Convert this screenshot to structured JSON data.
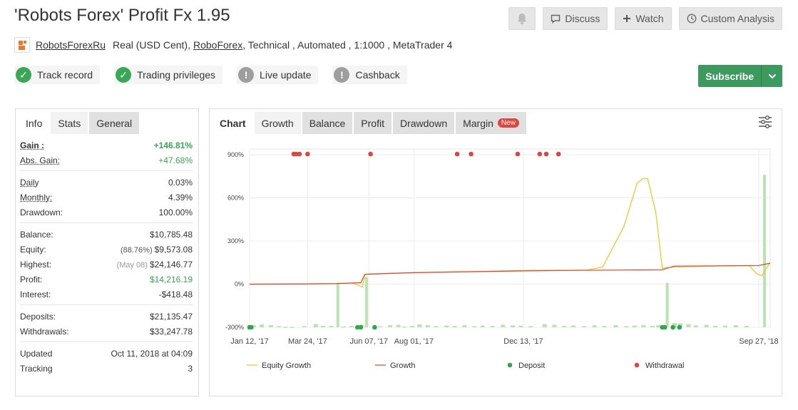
{
  "title": "'Robots Forex' Profit Fx 1.95",
  "header_buttons": {
    "discuss": "Discuss",
    "watch": "Watch",
    "custom_analysis": "Custom Analysis"
  },
  "subline": {
    "user": "RobotsForexRu",
    "account_type": "Real (USD Cent),",
    "broker": "RoboForex",
    "details": ", Technical , Automated , 1:1000 , MetaTrader 4"
  },
  "badges": [
    {
      "label": "Track record",
      "status": "ok"
    },
    {
      "label": "Trading privileges",
      "status": "ok"
    },
    {
      "label": "Live update",
      "status": "warn"
    },
    {
      "label": "Cashback",
      "status": "warn"
    }
  ],
  "subscribe_label": "Subscribe",
  "left_tabs": [
    "Info",
    "Stats",
    "General"
  ],
  "stats": {
    "gain": {
      "label": "Gain :",
      "value": "+146.81%"
    },
    "abs_gain": {
      "label": "Abs. Gain:",
      "value": "+47.68%"
    },
    "daily": {
      "label": "Daily",
      "value": "0.03%"
    },
    "monthly": {
      "label": "Monthly:",
      "value": "4.39%"
    },
    "drawdown": {
      "label": "Drawdown:",
      "value": "100.00%"
    },
    "balance": {
      "label": "Balance:",
      "value": "$10,785.48"
    },
    "equity": {
      "label": "Equity:",
      "note": "(88.76%)",
      "value": "$9,573.08"
    },
    "highest": {
      "label": "Highest:",
      "note": "(May 08)",
      "value": "$24,146.77"
    },
    "profit": {
      "label": "Profit:",
      "value": "$14,216.19"
    },
    "interest": {
      "label": "Interest:",
      "value": "-$418.48"
    },
    "deposits": {
      "label": "Deposits:",
      "value": "$21,135.47"
    },
    "withdrawals": {
      "label": "Withdrawals:",
      "value": "$33,247.78"
    },
    "updated": {
      "label": "Updated",
      "value": "Oct 11, 2018 at 04:09"
    },
    "tracking": {
      "label": "Tracking",
      "value": "3"
    }
  },
  "chart_tabs": {
    "chart": "Chart",
    "growth": "Growth",
    "balance": "Balance",
    "profit": "Profit",
    "drawdown": "Drawdown",
    "margin": "Margin",
    "new_badge": "New"
  },
  "colors": {
    "equity": "#f5c218",
    "growth": "#e8402a",
    "deposit": "#2ea84a",
    "withdrawal": "#e0443f",
    "bars": "#b9e3b2",
    "subscribe": "#3c9a5f"
  },
  "chart_data": {
    "type": "line",
    "x_range": [
      "2017-01-12",
      "2018-10-11"
    ],
    "x_ticks": [
      {
        "date": "2017-01-12",
        "label": "Jan 12, '17"
      },
      {
        "date": "2017-03-24",
        "label": "Mar 24, '17"
      },
      {
        "date": "2017-06-07",
        "label": "Jun 07, '17"
      },
      {
        "date": "2017-08-01",
        "label": "Aug 01, '17"
      },
      {
        "date": "2017-12-13",
        "label": "Dec 13, '17"
      },
      {
        "date": "2018-09-27",
        "label": "Sep 27, '18"
      }
    ],
    "y_ticks": [
      {
        "value": 900,
        "label": "900%"
      },
      {
        "value": 600,
        "label": "600%"
      },
      {
        "value": 300,
        "label": "300%"
      },
      {
        "value": 0,
        "label": "0%"
      },
      {
        "value": -300,
        "label": "-300%"
      }
    ],
    "ylim": [
      -300,
      900
    ],
    "series": [
      {
        "name": "Equity Growth",
        "points": [
          [
            "2017-01-12",
            0
          ],
          [
            "2017-03-24",
            2
          ],
          [
            "2017-04-28",
            3
          ],
          [
            "2017-05-08",
            5
          ],
          [
            "2017-05-18",
            8
          ],
          [
            "2017-05-26",
            -10
          ],
          [
            "2017-05-30",
            -22
          ],
          [
            "2017-06-02",
            65
          ],
          [
            "2017-06-07",
            70
          ],
          [
            "2017-08-01",
            80
          ],
          [
            "2017-12-13",
            95
          ],
          [
            "2018-02-01",
            96
          ],
          [
            "2018-03-01",
            98
          ],
          [
            "2018-03-20",
            120
          ],
          [
            "2018-04-15",
            400
          ],
          [
            "2018-05-01",
            700
          ],
          [
            "2018-05-08",
            735
          ],
          [
            "2018-05-14",
            735
          ],
          [
            "2018-05-24",
            500
          ],
          [
            "2018-06-01",
            110
          ],
          [
            "2018-06-15",
            120
          ],
          [
            "2018-08-01",
            125
          ],
          [
            "2018-09-15",
            130
          ],
          [
            "2018-09-25",
            70
          ],
          [
            "2018-10-01",
            60
          ],
          [
            "2018-10-11",
            150
          ]
        ]
      },
      {
        "name": "Growth",
        "points": [
          [
            "2017-01-12",
            0
          ],
          [
            "2017-03-24",
            2
          ],
          [
            "2017-04-28",
            4
          ],
          [
            "2017-05-28",
            10
          ],
          [
            "2017-06-02",
            68
          ],
          [
            "2017-06-07",
            70
          ],
          [
            "2017-08-01",
            80
          ],
          [
            "2017-12-13",
            92
          ],
          [
            "2018-02-01",
            95
          ],
          [
            "2018-06-01",
            100
          ],
          [
            "2018-06-15",
            125
          ],
          [
            "2018-09-27",
            130
          ],
          [
            "2018-10-11",
            146
          ]
        ]
      }
    ],
    "deposits": [
      "2017-01-12",
      "2017-01-14",
      "2017-05-24",
      "2017-05-28",
      "2017-06-14",
      "2018-06-01",
      "2018-06-04",
      "2018-06-14",
      "2018-06-22"
    ],
    "withdrawals": [
      "2017-03-07",
      "2017-03-10",
      "2017-03-14",
      "2017-03-24",
      "2017-06-09",
      "2017-09-23",
      "2017-10-10",
      "2017-12-06",
      "2018-01-02",
      "2018-01-10",
      "2018-01-25"
    ],
    "bars": [
      {
        "date": "2017-01-17",
        "value": -285
      },
      {
        "date": "2017-01-27",
        "value": -280
      },
      {
        "date": "2017-02-07",
        "value": -285
      },
      {
        "date": "2017-02-17",
        "value": -292
      },
      {
        "date": "2017-02-25",
        "value": -297
      },
      {
        "date": "2017-03-05",
        "value": -297
      },
      {
        "date": "2017-03-20",
        "value": -292
      },
      {
        "date": "2017-04-03",
        "value": -277
      },
      {
        "date": "2017-04-12",
        "value": -290
      },
      {
        "date": "2017-04-22",
        "value": -290
      },
      {
        "date": "2017-04-30",
        "value": 10
      },
      {
        "date": "2017-05-07",
        "value": -295
      },
      {
        "date": "2017-05-17",
        "value": -290
      },
      {
        "date": "2017-05-29",
        "value": -282
      },
      {
        "date": "2017-06-04",
        "value": 50
      },
      {
        "date": "2017-06-20",
        "value": -293
      },
      {
        "date": "2017-07-03",
        "value": -285
      },
      {
        "date": "2017-07-13",
        "value": -282
      },
      {
        "date": "2017-07-20",
        "value": -295
      },
      {
        "date": "2017-07-30",
        "value": -290
      },
      {
        "date": "2017-08-08",
        "value": -280
      },
      {
        "date": "2017-08-18",
        "value": -285
      },
      {
        "date": "2017-08-28",
        "value": -292
      },
      {
        "date": "2017-09-10",
        "value": -287
      },
      {
        "date": "2017-09-20",
        "value": -290
      },
      {
        "date": "2017-10-02",
        "value": -285
      },
      {
        "date": "2017-10-14",
        "value": -292
      },
      {
        "date": "2017-10-24",
        "value": -288
      },
      {
        "date": "2017-11-05",
        "value": -290
      },
      {
        "date": "2017-11-18",
        "value": -282
      },
      {
        "date": "2017-11-30",
        "value": -286
      },
      {
        "date": "2017-12-10",
        "value": -290
      },
      {
        "date": "2017-12-22",
        "value": -292
      },
      {
        "date": "2018-01-08",
        "value": -278
      },
      {
        "date": "2018-01-20",
        "value": -283
      },
      {
        "date": "2018-02-01",
        "value": -290
      },
      {
        "date": "2018-02-12",
        "value": -287
      },
      {
        "date": "2018-02-25",
        "value": -292
      },
      {
        "date": "2018-03-10",
        "value": -286
      },
      {
        "date": "2018-03-22",
        "value": -290
      },
      {
        "date": "2018-04-05",
        "value": -285
      },
      {
        "date": "2018-04-18",
        "value": -292
      },
      {
        "date": "2018-04-28",
        "value": -288
      },
      {
        "date": "2018-05-09",
        "value": -284
      },
      {
        "date": "2018-05-20",
        "value": -289
      },
      {
        "date": "2018-05-27",
        "value": -286
      },
      {
        "date": "2018-06-07",
        "value": 10
      },
      {
        "date": "2018-06-16",
        "value": -270
      },
      {
        "date": "2018-06-23",
        "value": -273
      },
      {
        "date": "2018-07-03",
        "value": -278
      },
      {
        "date": "2018-07-12",
        "value": -286
      },
      {
        "date": "2018-07-25",
        "value": -283
      },
      {
        "date": "2018-08-05",
        "value": -290
      },
      {
        "date": "2018-08-17",
        "value": -288
      },
      {
        "date": "2018-08-30",
        "value": -285
      },
      {
        "date": "2018-09-12",
        "value": -290
      },
      {
        "date": "2018-10-04",
        "value": 760
      }
    ],
    "legend": [
      "Equity Growth",
      "Growth",
      "Deposit",
      "Withdrawal"
    ],
    "grid": true
  }
}
